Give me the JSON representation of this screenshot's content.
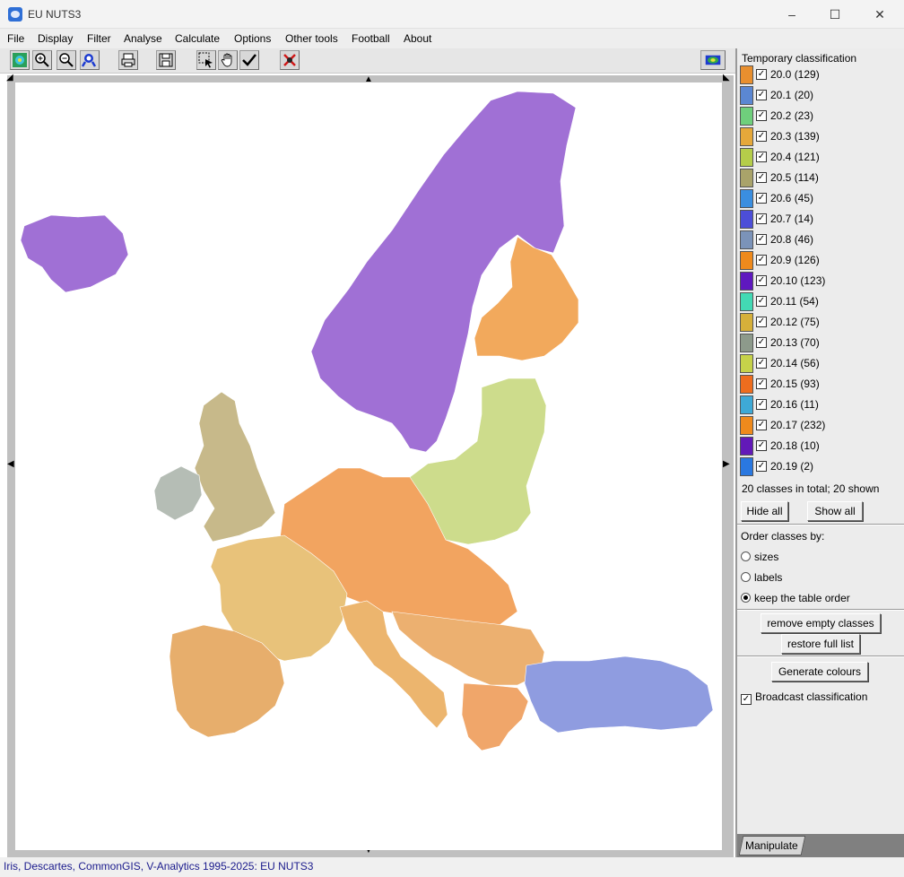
{
  "window": {
    "title": "EU NUTS3",
    "min_glyph": "–",
    "max_glyph": "☐",
    "close_glyph": "✕"
  },
  "menu": [
    "File",
    "Display",
    "Filter",
    "Analyse",
    "Calculate",
    "Options",
    "Other tools",
    "Football",
    "About"
  ],
  "toolbar": {
    "icons": [
      "map-overview-icon",
      "zoom-in-icon",
      "zoom-out-icon",
      "find-icon",
      "print-icon",
      "save-icon",
      "select-icon",
      "pan-icon",
      "check-icon",
      "remove-icon",
      "legend-icon"
    ]
  },
  "panel": {
    "title": "Temporary classification",
    "classes": [
      {
        "label": "20.0 (129)",
        "color": "#e88f2f"
      },
      {
        "label": "20.1 (20)",
        "color": "#5b87d2"
      },
      {
        "label": "20.2 (23)",
        "color": "#6fcf7c"
      },
      {
        "label": "20.3 (139)",
        "color": "#e5a83a"
      },
      {
        "label": "20.4 (121)",
        "color": "#b5cd4a"
      },
      {
        "label": "20.5 (114)",
        "color": "#a9a36a"
      },
      {
        "label": "20.6 (45)",
        "color": "#3a8ee0"
      },
      {
        "label": "20.7 (14)",
        "color": "#4c4ed8"
      },
      {
        "label": "20.8 (46)",
        "color": "#7b93b9"
      },
      {
        "label": "20.9 (126)",
        "color": "#ef8a1c"
      },
      {
        "label": "20.10 (123)",
        "color": "#5f18bf"
      },
      {
        "label": "20.11 (54)",
        "color": "#43d9b4"
      },
      {
        "label": "20.12 (75)",
        "color": "#d6b03a"
      },
      {
        "label": "20.13 (70)",
        "color": "#8d9a8b"
      },
      {
        "label": "20.14 (56)",
        "color": "#c6d24a"
      },
      {
        "label": "20.15 (93)",
        "color": "#ee6d1e"
      },
      {
        "label": "20.16 (11)",
        "color": "#3ea9d6"
      },
      {
        "label": "20.17 (232)",
        "color": "#ef8a1c"
      },
      {
        "label": "20.18 (10)",
        "color": "#6219b8"
      },
      {
        "label": "20.19 (2)",
        "color": "#2a78e0"
      }
    ],
    "summary": "20 classes in total; 20 shown",
    "hide_all": "Hide all",
    "show_all": "Show all",
    "order_label": "Order classes by:",
    "order_options": [
      "sizes",
      "labels",
      "keep the table order"
    ],
    "order_selected": "keep the table order",
    "remove_empty": "remove empty classes",
    "restore_full": "restore full list",
    "generate_colours": "Generate colours",
    "broadcast": "Broadcast classification",
    "broadcast_checked": true,
    "tab": "Manipulate"
  },
  "status": "Iris, Descartes, CommonGIS, V-Analytics 1995-2025: EU NUTS3",
  "map": {
    "regions": [
      {
        "name": "scandinavia",
        "color": "#a070d5"
      },
      {
        "name": "iceland",
        "color": "#a070d5"
      },
      {
        "name": "finland",
        "color": "#f2a95c"
      },
      {
        "name": "baltics-poland",
        "color": "#cddc8c"
      },
      {
        "name": "british-isles",
        "color": "#c7b98a"
      },
      {
        "name": "ireland",
        "color": "#b5bdb5"
      },
      {
        "name": "central-europe",
        "color": "#f2a460"
      },
      {
        "name": "france",
        "color": "#e8c27a"
      },
      {
        "name": "iberia",
        "color": "#e7ae6c"
      },
      {
        "name": "italy",
        "color": "#ecb56e"
      },
      {
        "name": "balkans",
        "color": "#ecb070"
      },
      {
        "name": "turkey",
        "color": "#8f9ce0"
      },
      {
        "name": "greece",
        "color": "#f0a66a"
      }
    ]
  }
}
